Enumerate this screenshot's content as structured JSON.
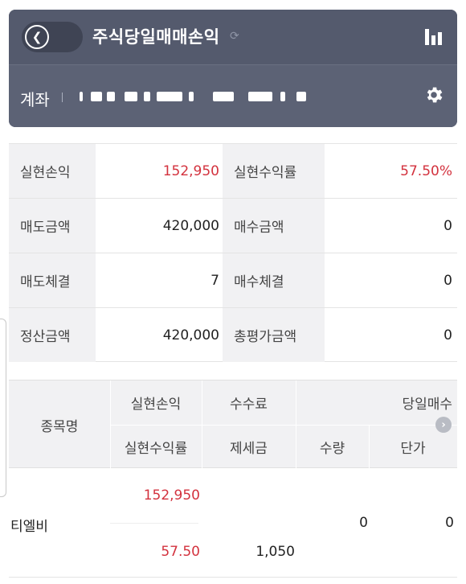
{
  "header": {
    "title": "주식당일매매손익",
    "back_icon": "chevron-left-icon",
    "refresh_icon": "refresh-icon",
    "chart_icon": "bar-chart-icon",
    "account_label": "계좌",
    "settings_icon": "gear-icon",
    "colors": {
      "title_bar": "#545a6d",
      "account_bar": "#5c6275"
    }
  },
  "summary": {
    "rows": [
      {
        "label1": "실현손익",
        "value1": "152,950",
        "label2": "실현수익률",
        "value2": "57.50%"
      },
      {
        "label1": "매도금액",
        "value1": "420,000",
        "label2": "매수금액",
        "value2": "0"
      },
      {
        "label1": "매도체결",
        "value1": "7",
        "label2": "매수체결",
        "value2": "0"
      },
      {
        "label1": "정산금액",
        "value1": "420,000",
        "label2": "총평가금액",
        "value2": "0"
      }
    ],
    "accent_red": "#d3323e"
  },
  "stock_table": {
    "headers": {
      "name": "종목명",
      "realized_pnl": "실현손익",
      "realized_rate": "실현수익률",
      "fee": "수수료",
      "tax": "제세금",
      "today_buy": "당일매수",
      "qty": "수량",
      "price": "단가"
    },
    "rows": [
      {
        "name": "티엘비",
        "realized_pnl": "152,950",
        "realized_rate": "57.50",
        "fee": "",
        "tax": "1,050",
        "qty": "0",
        "price": "0"
      }
    ]
  }
}
